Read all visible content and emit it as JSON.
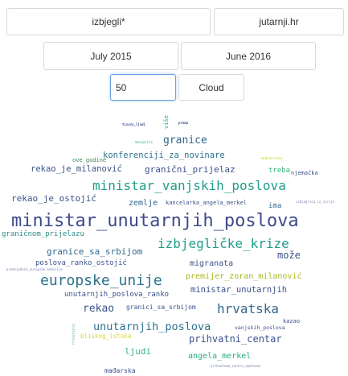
{
  "query": {
    "search_term": "izbjegli*",
    "source": "jutarnji.hr"
  },
  "dates": {
    "start": "July 2015",
    "end": "June 2016"
  },
  "controls": {
    "count_value": "50",
    "view_button": "Cloud"
  },
  "cloud_words": [
    {
      "text": "tisuća_ljudi",
      "color": "#3b528b"
    },
    {
      "text": "prema",
      "color": "#3b528b"
    },
    {
      "text": "više",
      "color": "#27ad81"
    },
    {
      "text": "margarita",
      "color": "#35b779"
    },
    {
      "text": "granice",
      "color": "#31688e"
    },
    {
      "text": "konferenciji_za_novinare",
      "color": "#2c728e"
    },
    {
      "text": "međunarodna",
      "color": "#bddf26"
    },
    {
      "text": "ove_godine",
      "color": "#3b8a4f"
    },
    {
      "text": "rekao_je_milanović",
      "color": "#3b528b"
    },
    {
      "text": "granični_prijelaz",
      "color": "#3b528b"
    },
    {
      "text": "treba",
      "color": "#35b779"
    },
    {
      "text": "njemačka",
      "color": "#3b528b"
    },
    {
      "text": "ministar_vanjskih_poslova",
      "color": "#1f9e89"
    },
    {
      "text": "rekao_je_ostojić",
      "color": "#3b528b"
    },
    {
      "text": "zemlje",
      "color": "#31688e"
    },
    {
      "text": "kancelarka_angela_merkel",
      "color": "#3b528b"
    },
    {
      "text": "ima",
      "color": "#31688e"
    },
    {
      "text": "izbjeglica_iz_sirije",
      "color": "#7a7fb0"
    },
    {
      "text": "ministar_unutarnjih_poslova",
      "color": "#3e4a89"
    },
    {
      "text": "graničnom_prijelazu",
      "color": "#2c8a8a"
    },
    {
      "text": "izbjegličke_krize",
      "color": "#1f9e89"
    },
    {
      "text": "granice_sa_srbijom",
      "color": "#31688e"
    },
    {
      "text": "može",
      "color": "#3b528b"
    },
    {
      "text": "poslova_ranko_ostojić",
      "color": "#3b528b"
    },
    {
      "text": "migranata",
      "color": "#3b528b"
    },
    {
      "text": "predsjednik_europske_komisije",
      "color": "#7a7fb0"
    },
    {
      "text": "europske_unije",
      "color": "#2c728e"
    },
    {
      "text": "premijer_zoran_milanović",
      "color": "#a8b820"
    },
    {
      "text": "ministar_unutarnjih",
      "color": "#3b528b"
    },
    {
      "text": "unutarnjih_poslova_ranko",
      "color": "#3b528b"
    },
    {
      "text": "rekao",
      "color": "#3b528b"
    },
    {
      "text": "granici_sa_srbijom",
      "color": "#3b528b"
    },
    {
      "text": "hrvatska",
      "color": "#31688e"
    },
    {
      "text": "hrvatskoj",
      "color": "#7ab8a0"
    },
    {
      "text": "unutarnjih_poslova",
      "color": "#2c728e"
    },
    {
      "text": "vanjskih_poslova",
      "color": "#3b528b"
    },
    {
      "text": "kazao",
      "color": "#3b528b"
    },
    {
      "text": "bliskog_istoka",
      "color": "#d9d937"
    },
    {
      "text": "prihvatni_centar",
      "color": "#3b528b"
    },
    {
      "text": "ljudi",
      "color": "#35b779"
    },
    {
      "text": "angela_merkel",
      "color": "#27ad81"
    },
    {
      "text": "mađarska",
      "color": "#3b528b"
    },
    {
      "text": "prihvatnom_centru_opatovac",
      "color": "#7a7fb0"
    }
  ]
}
